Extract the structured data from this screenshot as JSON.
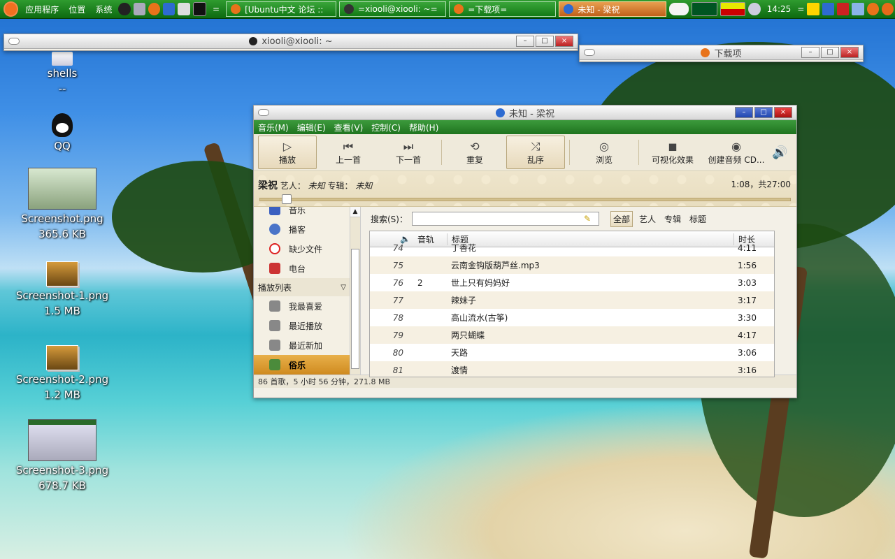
{
  "top_panel": {
    "menus": [
      "应用程序",
      "位置",
      "系统"
    ],
    "tasks": [
      {
        "label": "[Ubuntu中文 论坛 ::",
        "active": false
      },
      {
        "label": "=xiooli@xiooli: ~=",
        "active": false
      },
      {
        "label": "=下载项=",
        "active": false
      },
      {
        "label": "未知 - 梁祝",
        "active": true
      }
    ],
    "clock": "14:25",
    "separator": "="
  },
  "desktop": {
    "icons": [
      {
        "name": "shells",
        "size": "--"
      },
      {
        "name": "QQ",
        "size": ""
      },
      {
        "name": "Screenshot.png",
        "size": "365.6 KB"
      },
      {
        "name": "Screenshot-1.png",
        "size": "1.5 MB"
      },
      {
        "name": "Screenshot-2.png",
        "size": "1.2 MB"
      },
      {
        "name": "Screenshot-3.png",
        "size": "678.7 KB"
      }
    ]
  },
  "terminal": {
    "title": "xiooli@xiooli: ~"
  },
  "downloads": {
    "title": "下载项"
  },
  "player": {
    "title": "未知 - 梁祝",
    "menu": [
      "音乐(M)",
      "编辑(E)",
      "查看(V)",
      "控制(C)",
      "帮助(H)"
    ],
    "toolbar": {
      "play": "播放",
      "prev": "上一首",
      "next": "下一首",
      "repeat": "重复",
      "shuffle": "乱序",
      "browse": "浏览",
      "visual": "可视化效果",
      "create_cd": "创建音频 CD..."
    },
    "now_playing": {
      "song": "梁祝",
      "artist_label": "艺人：",
      "artist": "未知",
      "album_label": "专辑：",
      "album": "未知",
      "time": "1:08，共27:00",
      "progress_fraction": 0.042
    },
    "sidebar": {
      "library": [
        {
          "label": "音乐",
          "icon": "music-note-icon"
        },
        {
          "label": "播客",
          "icon": "podcast-icon"
        },
        {
          "label": "缺少文件",
          "icon": "missing-files-icon"
        },
        {
          "label": "电台",
          "icon": "radio-icon"
        }
      ],
      "playlist_header": "播放列表",
      "playlists": [
        {
          "label": "我最喜爱",
          "icon": "gear-icon"
        },
        {
          "label": "最近播放",
          "icon": "gear-icon"
        },
        {
          "label": "最近新加",
          "icon": "gear-icon"
        },
        {
          "label": "俗乐",
          "icon": "playlist-icon",
          "selected": true
        }
      ]
    },
    "search": {
      "label": "搜索(S)：",
      "value": ""
    },
    "filters": [
      "全部",
      "艺人",
      "专辑",
      "标题"
    ],
    "columns": [
      "音轨",
      "标题",
      "时长"
    ],
    "tracks": [
      {
        "num": "74",
        "track": "",
        "title": "丁香花",
        "duration": "4:11"
      },
      {
        "num": "75",
        "track": "",
        "title": "云南金钩版葫芦丝.mp3",
        "duration": "1:56"
      },
      {
        "num": "76",
        "track": "2",
        "title": "世上只有妈妈好",
        "duration": "3:03"
      },
      {
        "num": "77",
        "track": "",
        "title": "辣妹子",
        "duration": "3:17"
      },
      {
        "num": "78",
        "track": "",
        "title": "高山流水(古筝)",
        "duration": "3:30"
      },
      {
        "num": "79",
        "track": "",
        "title": "两只蝴蝶",
        "duration": "4:17"
      },
      {
        "num": "80",
        "track": "",
        "title": "天路",
        "duration": "3:06"
      },
      {
        "num": "81",
        "track": "",
        "title": "渡情",
        "duration": "3:16"
      }
    ],
    "status": "86 首歌，5 小时 56 分钟，271.8 MB"
  }
}
